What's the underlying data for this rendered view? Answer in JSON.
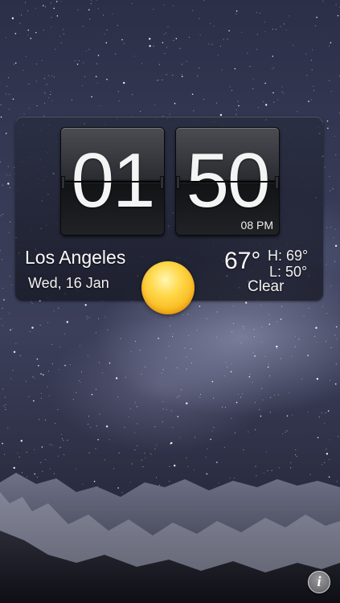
{
  "clock": {
    "hours": "01",
    "minutes": "50",
    "meridiem": "08 PM"
  },
  "location": {
    "city": "Los Angeles",
    "date": "Wed, 16 Jan"
  },
  "weather": {
    "icon": "sun-icon",
    "temperature": "67°",
    "high": "H: 69°",
    "low": "L: 50°",
    "condition": "Clear"
  },
  "controls": {
    "info_glyph": "i",
    "info_icon": "info-icon"
  },
  "colors": {
    "sun": "#f7b51a",
    "widget_panel": "#1c1e2c"
  }
}
